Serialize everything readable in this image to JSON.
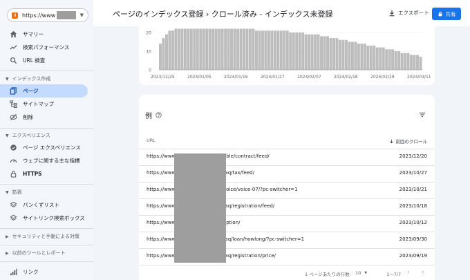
{
  "property": {
    "prefix": "https://www",
    "logo": "II"
  },
  "header": {
    "title": "ページのインデックス登録 › クロール済み - インデックス未登録",
    "export_label": "エクスポート",
    "share_label": "共有"
  },
  "sidebar": {
    "items_top": [
      {
        "label": "サマリー",
        "icon": "home-icon"
      },
      {
        "label": "検索パフォーマンス",
        "icon": "trending-icon"
      },
      {
        "label": "URL 検査",
        "icon": "search-icon"
      }
    ],
    "section_index": "インデックス作成",
    "items_index": [
      {
        "label": "ページ",
        "icon": "pages-icon",
        "active": true
      },
      {
        "label": "サイトマップ",
        "icon": "sitemap-icon"
      },
      {
        "label": "削除",
        "icon": "removal-icon"
      }
    ],
    "section_experience": "エクスペリエンス",
    "items_experience": [
      {
        "label": "ページ エクスペリエンス",
        "icon": "experience-icon"
      },
      {
        "label": "ウェブに関する主な指標",
        "icon": "vitals-icon"
      },
      {
        "label": "HTTPS",
        "icon": "lock-icon"
      }
    ],
    "section_enhancements": "拡張",
    "items_enhancements": [
      {
        "label": "パンくずリスト",
        "icon": "layers-icon"
      },
      {
        "label": "サイトリンク検索ボックス",
        "icon": "layers-icon"
      }
    ],
    "section_security": "セキュリティと手動による対策",
    "section_legacy": "以前のツールとレポート",
    "items_bottom": [
      {
        "label": "リンク",
        "icon": "links-icon"
      }
    ]
  },
  "chart_data": {
    "type": "bar",
    "y_ticks": [
      "20",
      "10",
      "0"
    ],
    "ylim": [
      0,
      22
    ],
    "x_ticks": [
      "2023/12/25",
      "2024/01/05",
      "2024/01/16",
      "2024/01/27",
      "2024/02/07",
      "2024/02/18",
      "2024/02/29",
      "2024/03/11"
    ],
    "values": [
      14,
      17,
      19,
      21,
      21,
      22,
      22,
      22,
      22,
      22,
      22,
      22,
      22,
      22,
      22,
      22,
      22,
      22,
      22,
      22,
      22,
      22,
      22,
      22,
      22,
      22,
      22,
      22,
      22,
      22,
      22,
      21,
      21,
      21,
      21,
      21,
      21,
      21,
      21,
      21,
      21,
      21,
      20,
      20,
      20,
      20,
      20,
      19,
      19,
      19,
      19,
      19,
      18,
      18,
      18,
      17,
      17,
      17,
      16,
      16,
      16,
      15,
      15,
      15,
      14,
      14,
      14,
      13,
      13,
      13,
      12,
      12,
      12,
      11,
      11,
      11,
      10,
      10,
      9,
      9,
      9,
      8,
      8,
      8,
      7
    ],
    "color": "#bdbdbd"
  },
  "table": {
    "title": "例",
    "col_url": "URL",
    "col_date": "前回のクロール",
    "rows": [
      {
        "url": "https://www.t",
        "path": "/able/contract/feed/",
        "date": "2023/12/20"
      },
      {
        "url": "https://www.t",
        "path": "/faq/tax/feed/",
        "date": "2023/10/27"
      },
      {
        "url": "https://www.t",
        "path": "/voice/voice-07/?pc-switcher=1",
        "date": "2023/10/21"
      },
      {
        "url": "https://www.t",
        "path": "/faq/registration/feed/",
        "date": "2023/10/18"
      },
      {
        "url": "https://www.t",
        "path": "/option/",
        "date": "2023/10/12"
      },
      {
        "url": "https://www.t",
        "path": "/faq/loan/howlong/?pc-switcher=1",
        "date": "2023/09/30"
      },
      {
        "url": "https://www.t",
        "path": "/faq/registration/price/",
        "date": "2023/09/19"
      }
    ],
    "footer": {
      "rows_per_page_label": "1 ページあたりの行数:",
      "rows_per_page": "10",
      "range": "1～7/7"
    }
  },
  "colors": {
    "accent": "#1a73e8",
    "active_bg": "#c2dbff",
    "sidebar_bg": "#f3f6fb",
    "bar": "#bdbdbd"
  }
}
